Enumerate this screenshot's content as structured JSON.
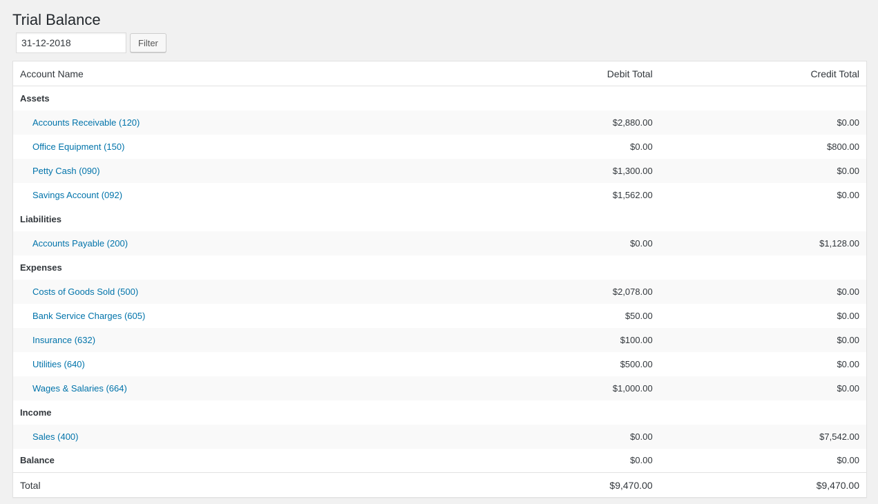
{
  "page": {
    "title": "Trial Balance"
  },
  "filter": {
    "date_value": "31-12-2018",
    "button_label": "Filter"
  },
  "table": {
    "headers": {
      "account": "Account Name",
      "debit": "Debit Total",
      "credit": "Credit Total"
    },
    "groups": [
      {
        "name": "Assets",
        "accounts": [
          {
            "name": "Accounts Receivable (120)",
            "debit": "$2,880.00",
            "credit": "$0.00"
          },
          {
            "name": "Office Equipment (150)",
            "debit": "$0.00",
            "credit": "$800.00"
          },
          {
            "name": "Petty Cash (090)",
            "debit": "$1,300.00",
            "credit": "$0.00"
          },
          {
            "name": "Savings Account (092)",
            "debit": "$1,562.00",
            "credit": "$0.00"
          }
        ]
      },
      {
        "name": "Liabilities",
        "accounts": [
          {
            "name": "Accounts Payable (200)",
            "debit": "$0.00",
            "credit": "$1,128.00"
          }
        ]
      },
      {
        "name": "Expenses",
        "accounts": [
          {
            "name": "Costs of Goods Sold (500)",
            "debit": "$2,078.00",
            "credit": "$0.00"
          },
          {
            "name": "Bank Service Charges (605)",
            "debit": "$50.00",
            "credit": "$0.00"
          },
          {
            "name": "Insurance (632)",
            "debit": "$100.00",
            "credit": "$0.00"
          },
          {
            "name": "Utilities (640)",
            "debit": "$500.00",
            "credit": "$0.00"
          },
          {
            "name": "Wages & Salaries (664)",
            "debit": "$1,000.00",
            "credit": "$0.00"
          }
        ]
      },
      {
        "name": "Income",
        "accounts": [
          {
            "name": "Sales (400)",
            "debit": "$0.00",
            "credit": "$7,542.00"
          }
        ]
      }
    ],
    "balance": {
      "label": "Balance",
      "debit": "$0.00",
      "credit": "$0.00"
    },
    "total": {
      "label": "Total",
      "debit": "$9,470.00",
      "credit": "$9,470.00"
    }
  }
}
